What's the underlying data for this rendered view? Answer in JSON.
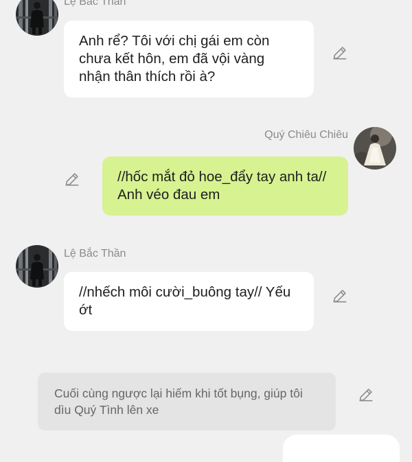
{
  "messages": [
    {
      "sender": "Lệ Bắc Thần",
      "text": "Anh rể? Tôi với chị gái em còn chưa kết hôn, em đã vội vàng nhận thân thích rồi à?",
      "avatar_icon": "character-avatar-dark",
      "edit_icon": "pencil-icon"
    },
    {
      "sender": "Quý Chiêu Chiêu",
      "text": "//hốc mắt đỏ hoe_đẩy tay anh ta// Anh véo đau em",
      "avatar_icon": "character-avatar-light",
      "edit_icon": "pencil-icon"
    },
    {
      "sender": "Lệ Bắc Thần",
      "text": "//nhếch môi cười_buông tay// Yếu ớt",
      "avatar_icon": "character-avatar-dark",
      "edit_icon": "pencil-icon"
    },
    {
      "text": "Cuối cùng ngược lại hiếm khi tốt bụng, giúp tôi dìu Quý Tình lên xe",
      "edit_icon": "pencil-icon"
    }
  ],
  "colors": {
    "background": "#f0f0f0",
    "incoming_bubble": "#ffffff",
    "outgoing_bubble": "#d7f291",
    "narration_bubble": "#e4e4e4",
    "name_text": "#8a8a8a"
  }
}
